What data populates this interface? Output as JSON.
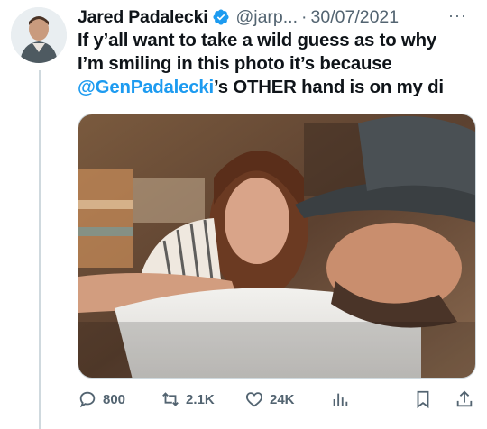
{
  "tweet": {
    "author": "Jared Padalecki",
    "handle": "@jarp...",
    "separator": "·",
    "date": "30/07/2021",
    "more": "···",
    "text_lines": [
      "If y’all want to take a wild guess as to why",
      "I’m smiling in this photo it’s because"
    ],
    "mention": "@GenPadalecki",
    "text_tail": "’s OTHER hand is on my di"
  },
  "actions": {
    "replies": "800",
    "retweets": "2.1K",
    "likes": "24K"
  },
  "icons": [
    "verified-badge-icon",
    "reply-icon",
    "retweet-icon",
    "like-icon",
    "views-icon",
    "bookmark-icon",
    "share-icon"
  ],
  "colors": {
    "link": "#1d9bf0",
    "verified": "#1d9bf0",
    "secondary_text": "#536471"
  }
}
